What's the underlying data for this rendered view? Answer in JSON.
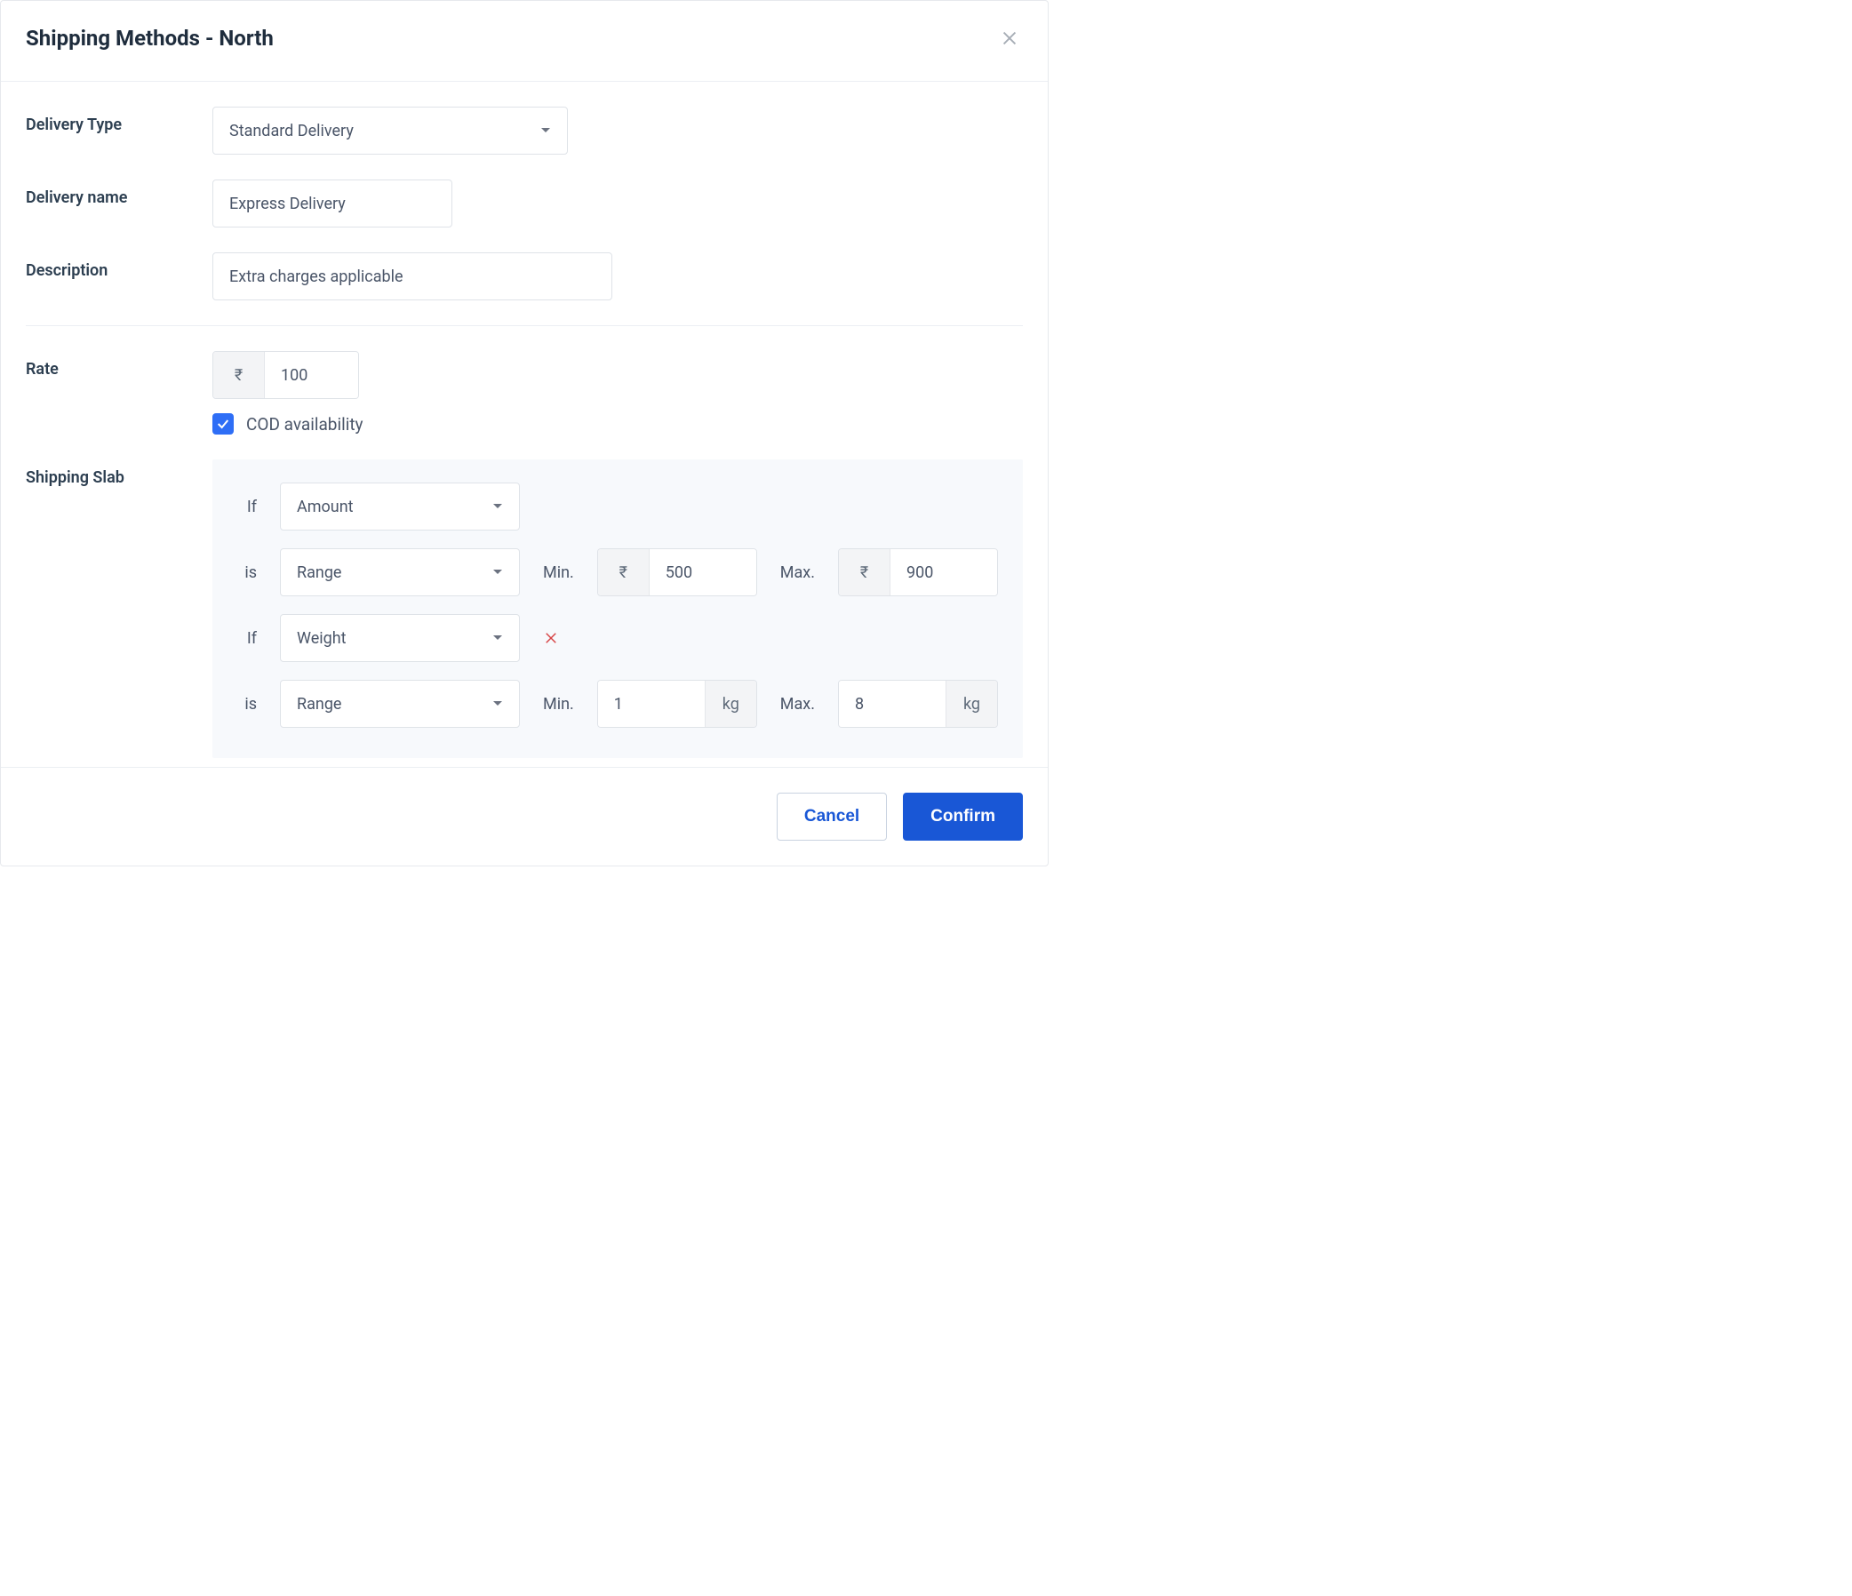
{
  "header": {
    "title": "Shipping Methods - North"
  },
  "labels": {
    "delivery_type": "Delivery Type",
    "delivery_name": "Delivery name",
    "description": "Description",
    "rate": "Rate",
    "shipping_slab": "Shipping Slab",
    "cod": "COD availability",
    "if": "If",
    "is": "is",
    "min": "Min.",
    "max": "Max."
  },
  "values": {
    "delivery_type": "Standard Delivery",
    "delivery_name": "Express Delivery",
    "description": "Extra charges applicable",
    "currency_symbol": "₹",
    "rate": "100",
    "cod_checked": true
  },
  "slab": {
    "condition1": {
      "metric": "Amount",
      "operator": "Range",
      "min": "500",
      "max": "900",
      "unit": "₹"
    },
    "condition2": {
      "metric": "Weight",
      "operator": "Range",
      "min": "1",
      "max": "8",
      "unit": "kg"
    }
  },
  "footer": {
    "cancel": "Cancel",
    "confirm": "Confirm"
  }
}
